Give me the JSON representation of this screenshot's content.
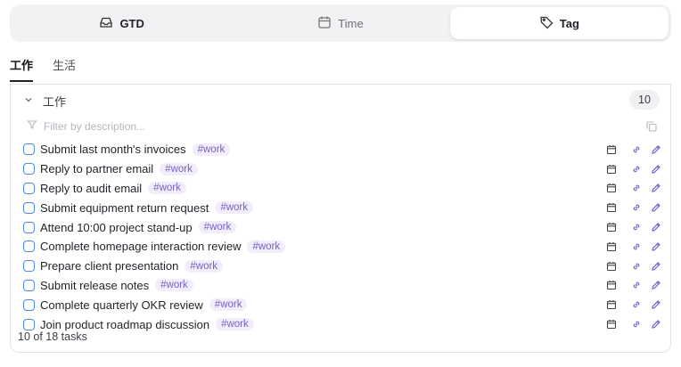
{
  "view_switch": {
    "items": [
      {
        "label": "GTD",
        "icon": "inbox-icon"
      },
      {
        "label": "Time",
        "icon": "calendar-icon"
      },
      {
        "label": "Tag",
        "icon": "tag-icon"
      }
    ],
    "active": "Tag"
  },
  "subtabs": [
    {
      "label": "工作",
      "active": true
    },
    {
      "label": "生活",
      "active": false
    }
  ],
  "group": {
    "title": "工作",
    "count": "10",
    "filter_placeholder": "Filter by description..."
  },
  "tasks": [
    {
      "text": "Submit last month's invoices",
      "tag": "#work"
    },
    {
      "text": "Reply to partner email",
      "tag": "#work"
    },
    {
      "text": "Reply to audit email",
      "tag": "#work"
    },
    {
      "text": "Submit equipment return request",
      "tag": "#work"
    },
    {
      "text": "Attend 10:00 project stand-up",
      "tag": "#work"
    },
    {
      "text": "Complete homepage interaction review",
      "tag": "#work"
    },
    {
      "text": "Prepare client presentation",
      "tag": "#work"
    },
    {
      "text": "Submit release notes",
      "tag": "#work"
    },
    {
      "text": "Complete quarterly OKR review",
      "tag": "#work"
    },
    {
      "text": "Join product roadmap discussion",
      "tag": "#work"
    }
  ],
  "footer": "10 of 18 tasks",
  "colors": {
    "checkbox": "#4a8ae6",
    "tag_bg": "#f1edfb",
    "tag_text": "#7b5fc7",
    "action_icon": "#7b5fc7"
  }
}
